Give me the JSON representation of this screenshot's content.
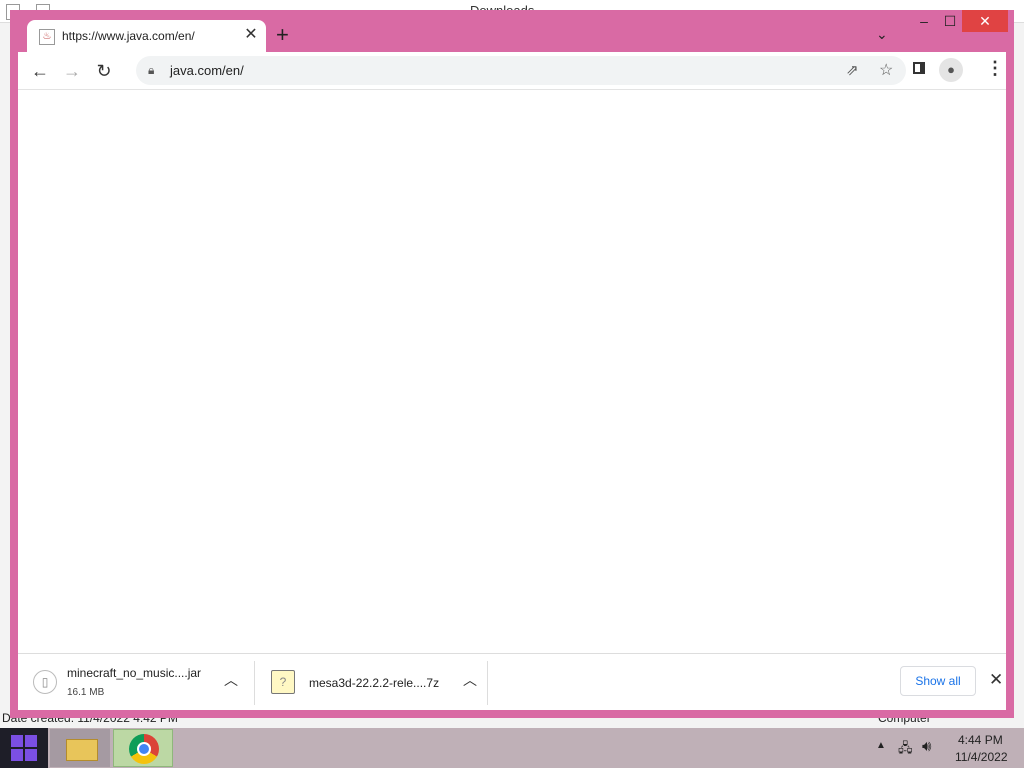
{
  "background_window": {
    "title": "Downloads",
    "status_left": "Date created: 11/4/2022 4:42 PM",
    "status_right": "Computer"
  },
  "browser": {
    "tab": {
      "title": "https://www.java.com/en/",
      "favicon": "java-icon"
    },
    "omnibox": {
      "url": "java.com/en/"
    },
    "download_bar": {
      "items": [
        {
          "name": "minecraft_no_music....jar",
          "size": "16.1 MB",
          "icon": "file-icon"
        },
        {
          "name": "mesa3d-22.2.2-rele....7z",
          "icon": "archive-icon"
        }
      ],
      "show_all_label": "Show all"
    },
    "colors": {
      "frame": "#d96aa4",
      "link": "#1a73e8"
    }
  },
  "taskbar": {
    "apps": [
      "file-explorer",
      "google-chrome"
    ],
    "clock_time": "4:44 PM",
    "clock_date": "11/4/2022"
  }
}
